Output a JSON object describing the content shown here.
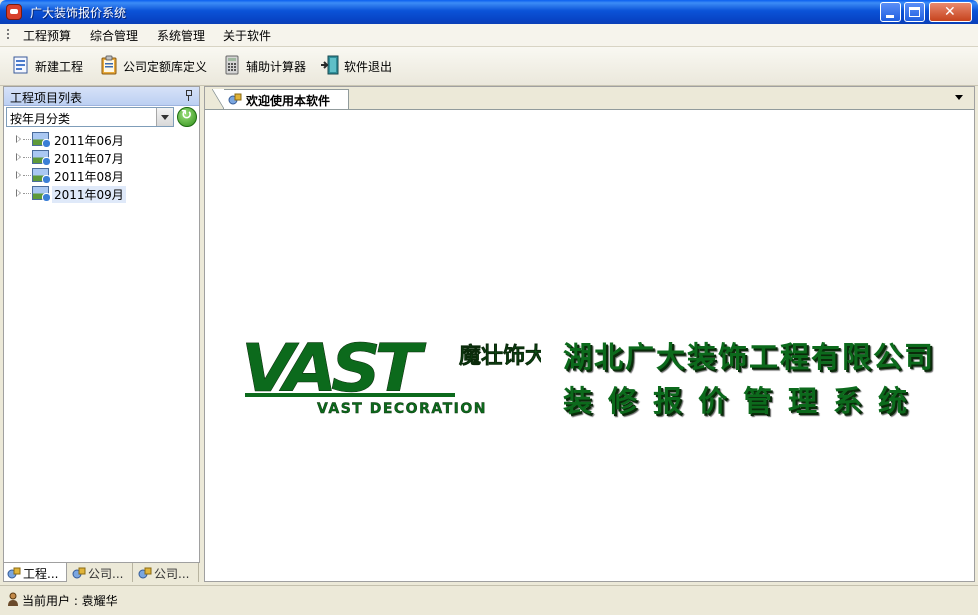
{
  "window": {
    "title": "广大装饰报价系统"
  },
  "menu": [
    "工程预算",
    "综合管理",
    "系统管理",
    "关于软件"
  ],
  "toolbar": {
    "new_project": "新建工程",
    "company_quota": "公司定额库定义",
    "calculator": "辅助计算器",
    "exit": "软件退出"
  },
  "left_panel": {
    "title": "工程项目列表",
    "group_by": "按年月分类",
    "tree": [
      {
        "label": "2011年06月"
      },
      {
        "label": "2011年07月"
      },
      {
        "label": "2011年08月"
      },
      {
        "label": "2011年09月",
        "selected": true
      }
    ],
    "bottom_tabs": [
      "工程...",
      "公司...",
      "公司..."
    ]
  },
  "main": {
    "tab_label": "欢迎使用本软件",
    "logo": {
      "text": "VAST",
      "subtitle": "VAST DECORATION",
      "chinese": "魔壮饰大衣佩"
    },
    "company_name": "湖北广大装饰工程有限公司",
    "system_name": "装修报价管理系统"
  },
  "status": {
    "current_user": "当前用户 : 袁耀华"
  },
  "colors": {
    "brand_green": "#0c6a1c",
    "titlebar_blue": "#0b53d8"
  }
}
